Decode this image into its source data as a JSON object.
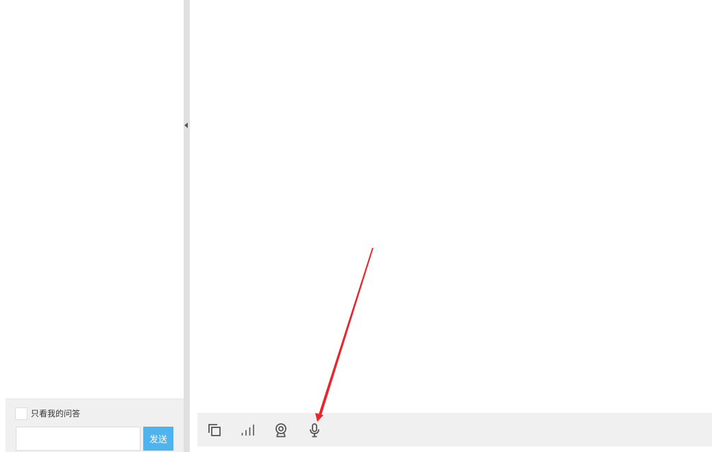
{
  "qa_panel": {
    "only_mine_label": "只看我的问答",
    "only_mine_checked": false,
    "input_value": "",
    "send_label": "发送"
  },
  "splitter": {
    "arrow_icon": "triangle-left-icon"
  },
  "toolbar": {
    "items": [
      {
        "icon": "copy-screens-icon"
      },
      {
        "icon": "signal-bars-icon"
      },
      {
        "icon": "webcam-icon"
      },
      {
        "icon": "microphone-icon"
      }
    ]
  },
  "colors": {
    "send_button_bg": "#4fb3ee",
    "toolbar_bg": "#f0f0f0",
    "annotation_arrow": "#e8262b",
    "icon": "#555555"
  }
}
